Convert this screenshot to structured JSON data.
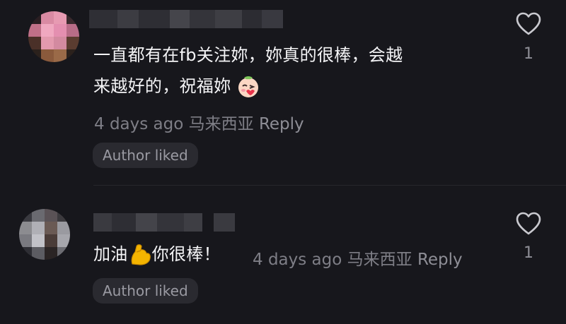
{
  "comments": [
    {
      "username": "",
      "text_line1": "一直都有在fb关注妳，妳真的很棒，会越",
      "text_line2": "来越好的，祝福妳",
      "emoji": "blushing-face-emoji",
      "timestamp": "4 days ago",
      "location": "马来西亚",
      "reply_label": "Reply",
      "badge": "Author liked",
      "likes": "1"
    },
    {
      "username": "",
      "text_before": "加油",
      "emoji": "flexed-biceps-emoji",
      "text_after": "你很棒！",
      "timestamp": "4 days ago",
      "location": "马来西亚",
      "reply_label": "Reply",
      "badge": "Author liked",
      "likes": "1"
    }
  ],
  "colors": {
    "background": "#17171c",
    "text": "#f4f4f6",
    "meta": "#7e7e86",
    "pill_bg": "#2a2a30"
  }
}
